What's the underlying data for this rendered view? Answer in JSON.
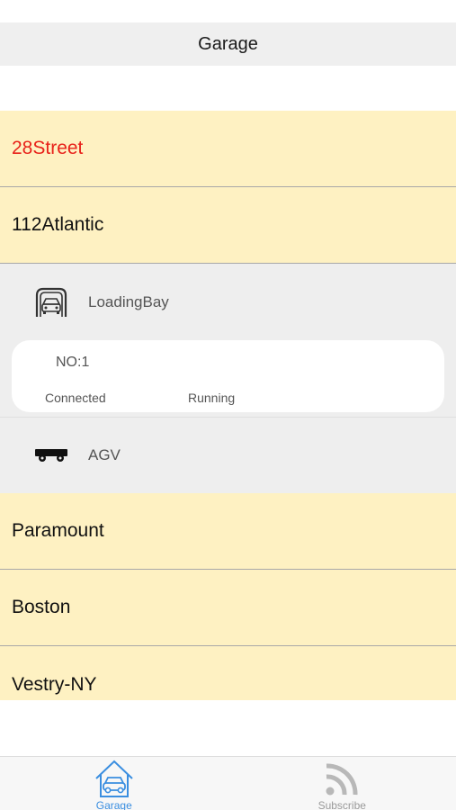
{
  "navbar": {
    "title": "Garage"
  },
  "garages": [
    {
      "name": "28Street"
    },
    {
      "name": "112Atlantic"
    },
    {
      "name": "Paramount"
    },
    {
      "name": "Boston"
    },
    {
      "name": "Vestry-NY"
    }
  ],
  "expanded": {
    "loading_bay": {
      "label": "LoadingBay",
      "icon": "garage-car-icon"
    },
    "device": {
      "number": "NO:1",
      "connection": "Connected",
      "status": "Running"
    },
    "agv": {
      "label": "AGV",
      "icon": "agv-cart-icon"
    }
  },
  "tabbar": {
    "garage": {
      "label": "Garage",
      "icon": "house-car-icon"
    },
    "subscribe": {
      "label": "Subscribe",
      "icon": "rss-feed-icon"
    }
  },
  "colors": {
    "row_bg": "#fef1c2",
    "active_text": "#e8221a",
    "tab_active": "#3a8ee0",
    "expanded_bg": "#eeeeee"
  }
}
